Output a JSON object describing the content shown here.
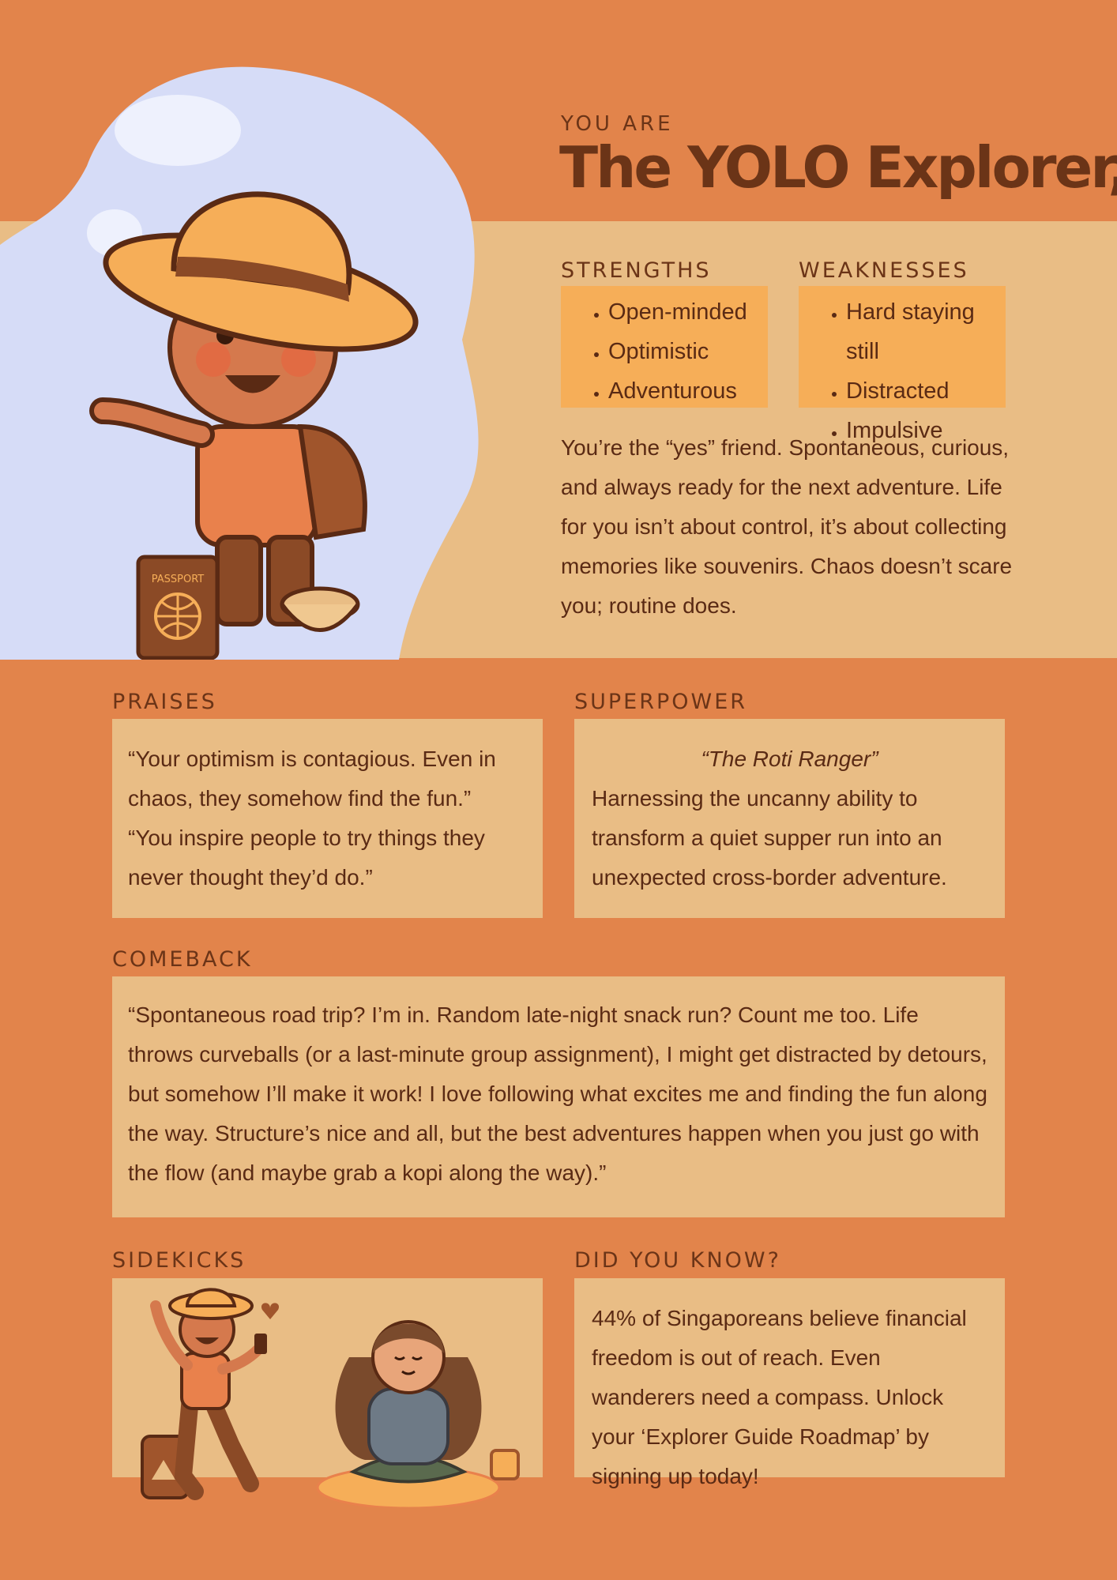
{
  "header": {
    "eyebrow": "YOU ARE",
    "title": "The YOLO Explorer,"
  },
  "strengths": {
    "heading": "STRENGTHS",
    "items": [
      "Open-minded",
      "Optimistic",
      "Adventurous"
    ]
  },
  "weaknesses": {
    "heading": "WEAKNESSES",
    "items": [
      "Hard staying still",
      "Distracted",
      "Impulsive"
    ]
  },
  "description": "You’re the “yes” friend. Spontaneous, curious, and always ready for the next adventure. Life for you isn’t about control, it’s about collecting memories like souvenirs. Chaos doesn’t scare you; routine does.",
  "praises": {
    "heading": "PRAISES",
    "quotes": [
      "“Your optimism is contagious. Even in chaos, they somehow find the fun.”",
      "“You inspire people to try things they never thought they’d do.”"
    ]
  },
  "superpower": {
    "heading": "SUPERPOWER",
    "name": "“The Roti Ranger”",
    "text": "Harnessing the uncanny ability to transform a quiet supper run into an unexpected cross-border adventure."
  },
  "comeback": {
    "heading": "COMEBACK",
    "text": "“Spontaneous road trip? I’m in. Random late-night snack run? Count me too. Life throws curveballs (or a last-minute group assignment), I might get distracted by detours, but somehow I’ll make it work! I love following what excites me and finding the fun along the way. Structure’s nice and all, but the best adventures happen when you just go with the flow (and maybe grab a kopi along the way).”"
  },
  "sidekicks": {
    "heading": "SIDEKICKS"
  },
  "did_you_know": {
    "heading": "DID YOU KNOW?",
    "text": "44% of Singaporeans believe financial freedom is out of reach. Even wanderers need a compass. Unlock your ‘Explorer Guide Roadmap’ by signing up today!"
  },
  "illustration": {
    "passport_label": "PASSPORT"
  },
  "colors": {
    "background": "#e2844b",
    "panel": "#e9bd85",
    "tag": "#f6ae58",
    "text": "#5a2a14",
    "cloud": "#d6dcf7"
  }
}
